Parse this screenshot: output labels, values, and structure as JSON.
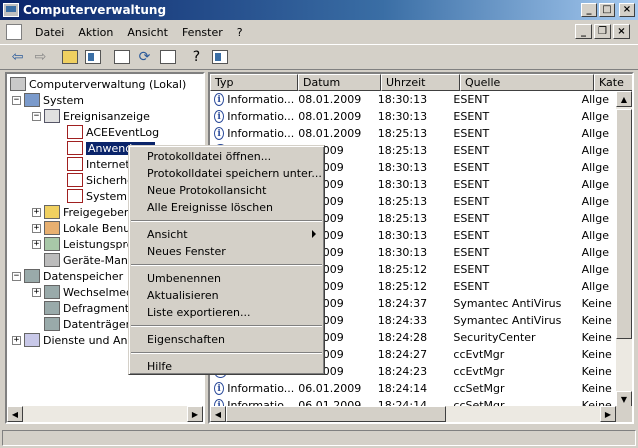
{
  "window": {
    "title": "Computerverwaltung"
  },
  "menubar": {
    "items": [
      "Datei",
      "Aktion",
      "Ansicht",
      "Fenster",
      "?"
    ]
  },
  "toolbar": {
    "icons": [
      "back-arrow-icon",
      "forward-arrow-icon",
      "up-folder-icon",
      "show-hide-tree-icon",
      "properties-icon",
      "refresh-icon",
      "export-list-icon",
      "help-icon",
      "console-icon"
    ]
  },
  "tree": {
    "items": [
      {
        "label": "Computerverwaltung (Lokal)",
        "icon": "computer-icon"
      },
      {
        "label": "System",
        "icon": "system-tools-icon"
      },
      {
        "label": "Ereignisanzeige",
        "icon": "event-viewer-icon"
      },
      {
        "label": "ACEEventLog",
        "icon": "log-icon"
      },
      {
        "label": "Anwendung",
        "icon": "log-icon"
      },
      {
        "label": "Internet",
        "icon": "log-icon"
      },
      {
        "label": "Sicherhe",
        "icon": "log-icon"
      },
      {
        "label": "System",
        "icon": "log-icon"
      },
      {
        "label": "Freigegeben",
        "icon": "shared-folders-icon"
      },
      {
        "label": "Lokale Benut",
        "icon": "users-icon"
      },
      {
        "label": "Leistungspro",
        "icon": "performance-icon"
      },
      {
        "label": "Geräte-Mana",
        "icon": "device-manager-icon"
      },
      {
        "label": "Datenspeicher",
        "icon": "storage-icon"
      },
      {
        "label": "Wechselmed",
        "icon": "removable-storage-icon"
      },
      {
        "label": "Defragmenti",
        "icon": "defrag-icon"
      },
      {
        "label": "Datenträger",
        "icon": "disk-management-icon"
      },
      {
        "label": "Dienste und Anw",
        "icon": "services-icon"
      }
    ]
  },
  "list": {
    "columns": [
      "Typ",
      "Datum",
      "Uhrzeit",
      "Quelle",
      "Kate"
    ],
    "rows": [
      {
        "type": "Informatio...",
        "date": "08.01.2009",
        "time": "18:30:13",
        "source": "ESENT",
        "cat": "Allge"
      },
      {
        "type": "Informatio...",
        "date": "08.01.2009",
        "time": "18:30:13",
        "source": "ESENT",
        "cat": "Allge"
      },
      {
        "type": "Informatio...",
        "date": "08.01.2009",
        "time": "18:25:13",
        "source": "ESENT",
        "cat": "Allge"
      },
      {
        "type": "",
        "date": "01.2009",
        "time": "18:25:13",
        "source": "ESENT",
        "cat": "Allge"
      },
      {
        "type": "",
        "date": "01.2009",
        "time": "18:30:13",
        "source": "ESENT",
        "cat": "Allge"
      },
      {
        "type": "",
        "date": "01.2009",
        "time": "18:30:13",
        "source": "ESENT",
        "cat": "Allge"
      },
      {
        "type": "",
        "date": "01.2009",
        "time": "18:25:13",
        "source": "ESENT",
        "cat": "Allge"
      },
      {
        "type": "",
        "date": "01.2009",
        "time": "18:25:13",
        "source": "ESENT",
        "cat": "Allge"
      },
      {
        "type": "",
        "date": "01.2009",
        "time": "18:30:13",
        "source": "ESENT",
        "cat": "Allge"
      },
      {
        "type": "",
        "date": "01.2009",
        "time": "18:30:13",
        "source": "ESENT",
        "cat": "Allge"
      },
      {
        "type": "",
        "date": "01.2009",
        "time": "18:25:12",
        "source": "ESENT",
        "cat": "Allge"
      },
      {
        "type": "",
        "date": "01.2009",
        "time": "18:25:12",
        "source": "ESENT",
        "cat": "Allge"
      },
      {
        "type": "",
        "date": "01.2009",
        "time": "18:24:37",
        "source": "Symantec AntiVirus",
        "cat": "Keine"
      },
      {
        "type": "",
        "date": "01.2009",
        "time": "18:24:33",
        "source": "Symantec AntiVirus",
        "cat": "Keine"
      },
      {
        "type": "",
        "date": "01.2009",
        "time": "18:24:28",
        "source": "SecurityCenter",
        "cat": "Keine"
      },
      {
        "type": "",
        "date": "01.2009",
        "time": "18:24:27",
        "source": "ccEvtMgr",
        "cat": "Keine"
      },
      {
        "type": "",
        "date": "01.2009",
        "time": "18:24:23",
        "source": "ccEvtMgr",
        "cat": "Keine"
      },
      {
        "type": "Informatio...",
        "date": "06.01.2009",
        "time": "18:24:14",
        "source": "ccSetMgr",
        "cat": "Keine"
      },
      {
        "type": "Informatio...",
        "date": "06.01.2009",
        "time": "18:24:14",
        "source": "ccSetMgr",
        "cat": "Keine"
      }
    ]
  },
  "context_menu": {
    "items": [
      {
        "label": "Protokolldatei öffnen...",
        "name": "ctx-open-log"
      },
      {
        "label": "Protokolldatei speichern unter...",
        "name": "ctx-save-log-as"
      },
      {
        "label": "Neue Protokollansicht",
        "name": "ctx-new-log-view"
      },
      {
        "label": "Alle Ereignisse löschen",
        "name": "ctx-clear-all-events"
      },
      {
        "sep": true
      },
      {
        "label": "Ansicht",
        "name": "ctx-view",
        "submenu": true
      },
      {
        "label": "Neues Fenster",
        "name": "ctx-new-window"
      },
      {
        "sep": true
      },
      {
        "label": "Umbenennen",
        "name": "ctx-rename"
      },
      {
        "label": "Aktualisieren",
        "name": "ctx-refresh"
      },
      {
        "label": "Liste exportieren...",
        "name": "ctx-export-list"
      },
      {
        "sep": true
      },
      {
        "label": "Eigenschaften",
        "name": "ctx-properties"
      },
      {
        "sep": true
      },
      {
        "label": "Hilfe",
        "name": "ctx-help"
      }
    ]
  }
}
